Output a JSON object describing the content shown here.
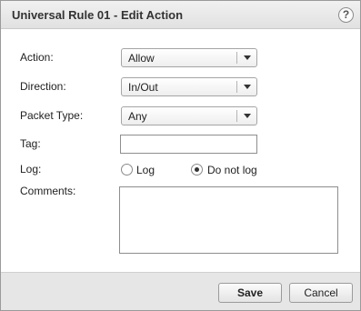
{
  "dialog": {
    "title": "Universal Rule 01 - Edit Action",
    "help_symbol": "?"
  },
  "form": {
    "action": {
      "label": "Action:",
      "value": "Allow"
    },
    "direction": {
      "label": "Direction:",
      "value": "In/Out"
    },
    "packet_type": {
      "label": "Packet Type:",
      "value": "Any"
    },
    "tag": {
      "label": "Tag:",
      "value": ""
    },
    "log": {
      "label": "Log:",
      "options": [
        {
          "label": "Log",
          "selected": false
        },
        {
          "label": "Do not log",
          "selected": true
        }
      ]
    },
    "comments": {
      "label": "Comments:",
      "value": ""
    }
  },
  "footer": {
    "save_label": "Save",
    "cancel_label": "Cancel"
  }
}
